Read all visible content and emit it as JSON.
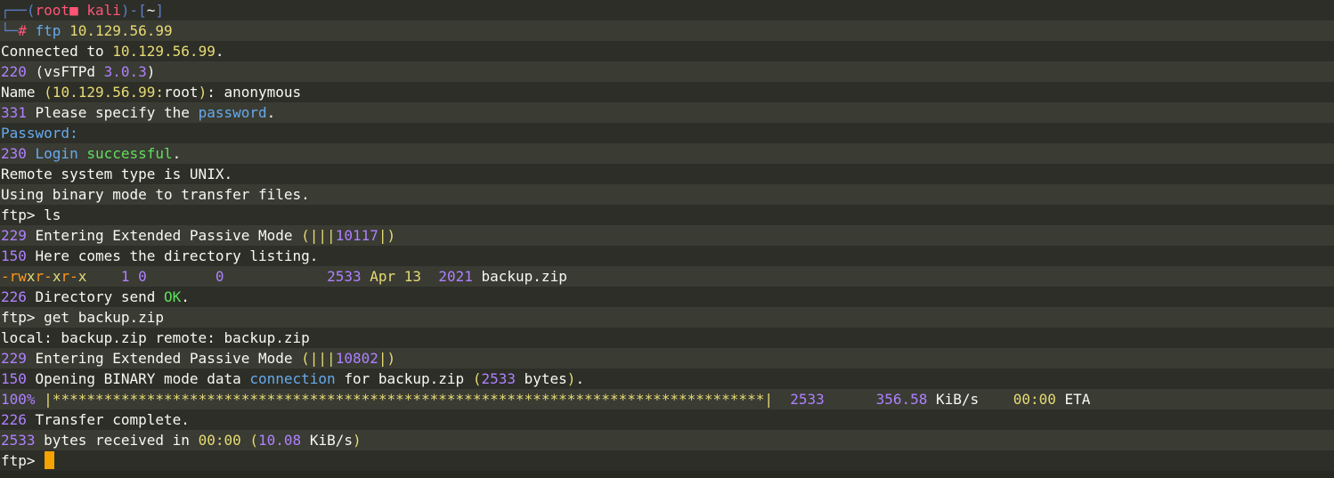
{
  "colors": {
    "default": "#f8f8f2",
    "number": "#ae81ff",
    "string": "#e6db74",
    "keyword": "#66aaee",
    "success": "#5ee05e",
    "prompt_frame": "#5a7ec7",
    "prompt_red": "#ff5577",
    "flag": "#fd971f",
    "cursor": "#f5a300"
  },
  "terminal": {
    "lines": [
      [
        [
          "┌──(",
          "prompt_frame"
        ],
        [
          "root",
          "prompt_red"
        ],
        [
          "■",
          "prompt_red"
        ],
        [
          " kali",
          "prompt_red"
        ],
        [
          ")-[",
          "prompt_frame"
        ],
        [
          "~",
          "default"
        ],
        [
          "]",
          "prompt_frame"
        ]
      ],
      [
        [
          "└─",
          "prompt_frame"
        ],
        [
          "# ",
          "prompt_red"
        ],
        [
          "ftp ",
          "keyword"
        ],
        [
          "10.129.56.99",
          "string"
        ]
      ],
      [
        [
          "Connected to ",
          "default"
        ],
        [
          "10.129.56.99",
          "string"
        ],
        [
          ".",
          "default"
        ]
      ],
      [
        [
          "220 ",
          "number"
        ],
        [
          "(vsFTPd ",
          "default"
        ],
        [
          "3.0.3",
          "number"
        ],
        [
          ")",
          "default"
        ]
      ],
      [
        [
          "Name ",
          "default"
        ],
        [
          "(10.129.56.99:",
          "string"
        ],
        [
          "root",
          "default"
        ],
        [
          ")",
          "string"
        ],
        [
          ": anonymous",
          "default"
        ]
      ],
      [
        [
          "331 ",
          "number"
        ],
        [
          "Please specify the ",
          "default"
        ],
        [
          "password",
          "keyword"
        ],
        [
          ".",
          "default"
        ]
      ],
      [
        [
          "Password:",
          "keyword"
        ]
      ],
      [
        [
          "230 ",
          "number"
        ],
        [
          "Login ",
          "keyword"
        ],
        [
          "successful",
          "success"
        ],
        [
          ".",
          "default"
        ]
      ],
      [
        [
          "Remote system type is UNIX.",
          "default"
        ]
      ],
      [
        [
          "Using binary mode to transfer files.",
          "default"
        ]
      ],
      [
        [
          "ftp> ls",
          "default"
        ]
      ],
      [
        [
          "229 ",
          "number"
        ],
        [
          "Entering Extended Passive Mode ",
          "default"
        ],
        [
          "(|||",
          "string"
        ],
        [
          "10117",
          "number"
        ],
        [
          "|)",
          "string"
        ]
      ],
      [
        [
          "150 ",
          "number"
        ],
        [
          "Here comes the directory listing.",
          "default"
        ]
      ],
      [
        [
          "-rw",
          "flag"
        ],
        [
          "x",
          "string"
        ],
        [
          "r-",
          "flag"
        ],
        [
          "x",
          "string"
        ],
        [
          "r-",
          "flag"
        ],
        [
          "x",
          "string"
        ],
        [
          "    ",
          "default"
        ],
        [
          "1 0",
          "number"
        ],
        [
          "        ",
          "default"
        ],
        [
          "0",
          "number"
        ],
        [
          "            ",
          "default"
        ],
        [
          "2533 ",
          "number"
        ],
        [
          "Apr 13  ",
          "string"
        ],
        [
          "2021 ",
          "number"
        ],
        [
          "backup.zip",
          "default"
        ]
      ],
      [
        [
          "226 ",
          "number"
        ],
        [
          "Directory send ",
          "default"
        ],
        [
          "OK",
          "success"
        ],
        [
          ".",
          "default"
        ]
      ],
      [
        [
          "ftp> get backup.zip",
          "default"
        ]
      ],
      [
        [
          "local: backup.zip remote: backup.zip",
          "default"
        ]
      ],
      [
        [
          "229 ",
          "number"
        ],
        [
          "Entering Extended Passive Mode ",
          "default"
        ],
        [
          "(|||",
          "string"
        ],
        [
          "10802",
          "number"
        ],
        [
          "|)",
          "string"
        ]
      ],
      [
        [
          "150 ",
          "number"
        ],
        [
          "Opening BINARY mode data ",
          "default"
        ],
        [
          "connection",
          "keyword"
        ],
        [
          " for backup.zip ",
          "default"
        ],
        [
          "(",
          "string"
        ],
        [
          "2533 ",
          "number"
        ],
        [
          "bytes",
          "default"
        ],
        [
          ")",
          "string"
        ],
        [
          ".",
          "default"
        ]
      ],
      [
        [
          "100% ",
          "number"
        ],
        [
          "|***********************************************************************************|",
          "string"
        ],
        [
          "  ",
          "default"
        ],
        [
          "2533",
          "number"
        ],
        [
          "      ",
          "default"
        ],
        [
          "356.58 ",
          "number"
        ],
        [
          "KiB/s",
          "default"
        ],
        [
          "    ",
          "default"
        ],
        [
          "00:00",
          "string"
        ],
        [
          " ETA",
          "default"
        ]
      ],
      [
        [
          "226 ",
          "number"
        ],
        [
          "Transfer complete.",
          "default"
        ]
      ],
      [
        [
          "2533 ",
          "number"
        ],
        [
          "bytes received in ",
          "default"
        ],
        [
          "00:00",
          "string"
        ],
        [
          " ",
          "default"
        ],
        [
          "(",
          "string"
        ],
        [
          "10.08 ",
          "number"
        ],
        [
          "KiB/s",
          "default"
        ],
        [
          ")",
          "string"
        ]
      ],
      [
        [
          "ftp> ",
          "default"
        ]
      ]
    ]
  }
}
